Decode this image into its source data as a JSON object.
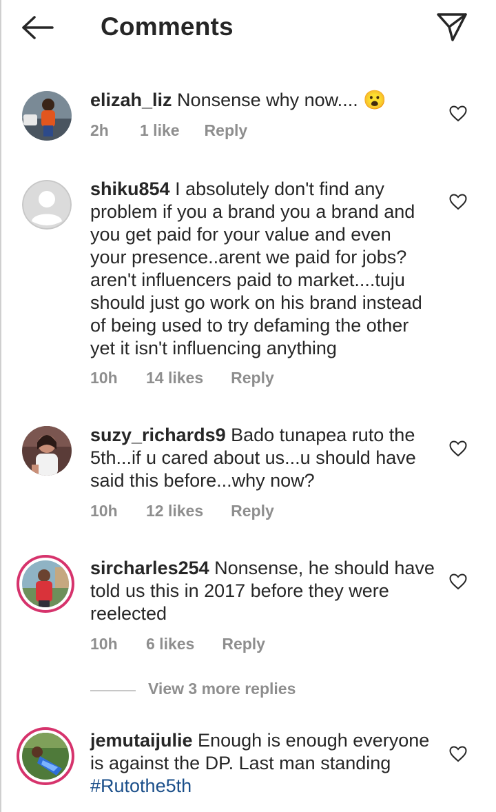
{
  "header": {
    "title": "Comments",
    "back_icon": "back-arrow-icon",
    "send_icon": "paper-plane-icon"
  },
  "comments": [
    {
      "username": "elizah_liz",
      "text": " Nonsense why now.... ",
      "emoji": "😮",
      "time": "2h",
      "likes": "1 like",
      "reply": "Reply"
    },
    {
      "username": "shiku854",
      "text": " I absolutely don't find any problem if you a brand you a brand and you get paid for your value and even your presence..arent we paid for jobs? aren't influencers paid to market....tuju should just go work on his brand instead of being used to try defaming the other yet it isn't influencing anything",
      "time": "10h",
      "likes": "14 likes",
      "reply": "Reply"
    },
    {
      "username": "suzy_richards9",
      "text": " Bado tunapea ruto the 5th...if u cared about us...u should have said this before...why now?",
      "time": "10h",
      "likes": "12 likes",
      "reply": "Reply"
    },
    {
      "username": "sircharles254",
      "text": " Nonsense, he should have told us this in 2017 before they were reelected",
      "time": "10h",
      "likes": "6 likes",
      "reply": "Reply"
    },
    {
      "username": "jemutaijulie",
      "text": " Enough is enough everyone is against the DP. Last man standing ",
      "hashtag": "#Rutothe5th"
    }
  ],
  "view_more_replies": "View 3 more replies",
  "colors": {
    "text": "#262626",
    "meta": "#8e8e8e",
    "hashtag": "#1b4f8a",
    "story_ring": "#d6336c"
  }
}
